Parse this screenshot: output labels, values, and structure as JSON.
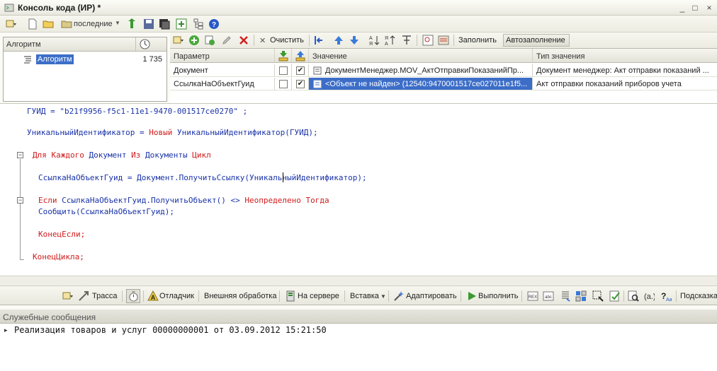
{
  "window": {
    "title": "Консоль кода (ИР) *",
    "controls": [
      "_",
      "□",
      "×"
    ]
  },
  "toolbar1": {
    "recent_label": "последние"
  },
  "tree": {
    "header": "Алгоритм",
    "item_label": "Алгоритм",
    "item_value": "1 735"
  },
  "param_toolbar": {
    "clear_label": "Очистить",
    "fill_label": "Заполнить",
    "autofill_label": "Автозаполнение"
  },
  "param_table": {
    "columns": [
      "Параметр",
      "",
      "",
      "Значение",
      "Тип значения"
    ],
    "rows": [
      {
        "param": "Документ",
        "check1": false,
        "check2": true,
        "value": "ДокументМенеджер.MOV_АктОтправкиПоказанийПр...",
        "type": "Документ менеджер: Акт отправки показаний ..."
      },
      {
        "param": "СсылкаНаОбъектГуид",
        "check1": false,
        "check2": true,
        "value": "<Объект не найден> (12540:9470001517ce027011e1f5...",
        "type": "Акт отправки показаний приборов учета"
      }
    ]
  },
  "code": {
    "line1_id": "ГУИД",
    "line1_rest": " = \"b21f9956-f5c1-11e1-9470-001517ce0270\" ;",
    "line2_a": "УникальныйИдентификатор",
    "line2_b": " = ",
    "line2_kw": "Новый",
    "line2_c": " УникальныйИдентификатор(ГУИД);",
    "line3_kw1": "Для Каждого",
    "line3_id1": " Документ ",
    "line3_kw2": "Из",
    "line3_id2": " Документы ",
    "line3_kw3": "Цикл",
    "line4": "СсылкаНаОбъектГуид = Документ.ПолучитьСсылку(УникальныйИдентификатор);",
    "line5_kw1": "Если",
    "line5_id": " СсылкаНаОбъектГуид.ПолучитьОбъект() <> ",
    "line5_kw2": "Неопределено Тогда",
    "line6": "Сообщить(СсылкаНаОбъектГуид);",
    "line7": "КонецЕсли;",
    "line8": "КонецЦикла;"
  },
  "bottom_toolbar": {
    "trace": "Трасса",
    "debugger": "Отладчик",
    "external": "Внешняя обработка",
    "server": "На сервере",
    "insert": "Вставка",
    "adapt": "Адаптировать",
    "run": "Выполнить",
    "hint": "Подсказка"
  },
  "messages": {
    "header": "Служебные сообщения",
    "items": [
      "Реализация товаров и услуг 00000000001 от 03.09.2012 15:21:50"
    ]
  }
}
